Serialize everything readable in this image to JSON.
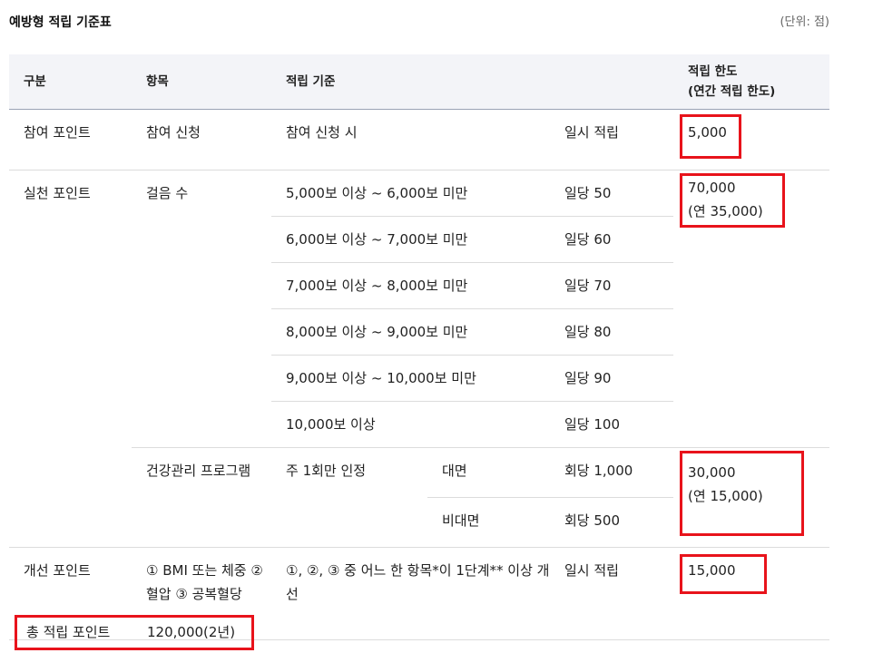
{
  "title": "예방형 적립 기준표",
  "unit_note": "(단위: 점)",
  "headers": {
    "category": "구분",
    "item": "항목",
    "criteria": "적립 기준",
    "limit_line1": "적립 한도",
    "limit_line2": "(연간 적립 한도)"
  },
  "participation": {
    "category": "참여 포인트",
    "item": "참여 신청",
    "criteria": "참여 신청 시",
    "rate": "일시 적립",
    "limit": "5,000"
  },
  "practice": {
    "category": "실천 포인트",
    "steps": {
      "item": "걸음 수",
      "limit_line1": "70,000",
      "limit_line2": "(연 35,000)",
      "rows": [
        {
          "criteria": "5,000보 이상 ~ 6,000보 미만",
          "rate": "일당 50"
        },
        {
          "criteria": "6,000보 이상 ~ 7,000보 미만",
          "rate": "일당 60"
        },
        {
          "criteria": "7,000보 이상 ~ 8,000보 미만",
          "rate": "일당 70"
        },
        {
          "criteria": "8,000보 이상 ~ 9,000보 미만",
          "rate": "일당 80"
        },
        {
          "criteria": "9,000보 이상 ~ 10,000보 미만",
          "rate": "일당 90"
        },
        {
          "criteria": "10,000보 이상",
          "rate": "일당 100"
        }
      ]
    },
    "program": {
      "item": "건강관리 프로그램",
      "criteria": "주 1회만 인정",
      "limit_line1": "30,000",
      "limit_line2": "(연 15,000)",
      "rows": [
        {
          "mode": "대면",
          "rate": "회당 1,000"
        },
        {
          "mode": "비대면",
          "rate": "회당 500"
        }
      ]
    }
  },
  "improvement": {
    "category": "개선 포인트",
    "item": "① BMI 또는 체중 ② 혈압 ③ 공복혈당",
    "criteria": "①, ②, ③ 중 어느 한 항목*이 1단계** 이상 개선",
    "rate": "일시 적립",
    "limit": "15,000"
  },
  "total": {
    "label": "총 적립 포인트",
    "value": "120,000(2년)"
  },
  "colors": {
    "highlight_border": "#e8131b",
    "header_bg": "#f3f4f8"
  }
}
